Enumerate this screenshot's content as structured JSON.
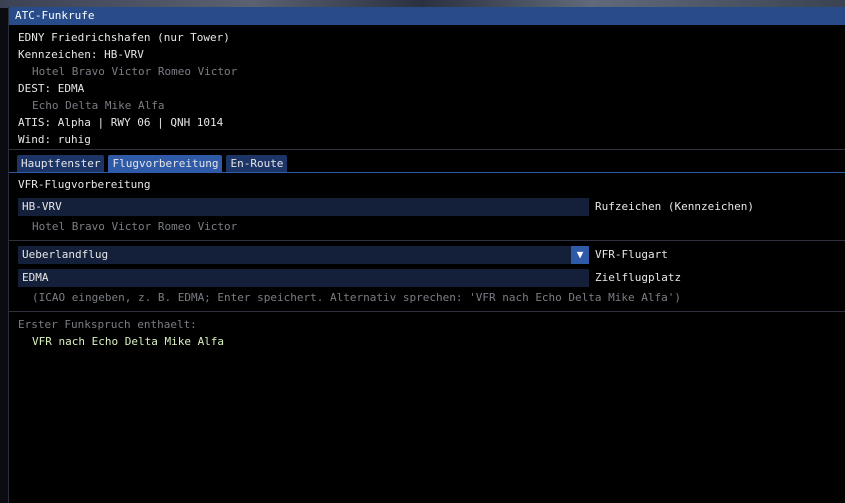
{
  "window": {
    "title": "ATC-Funkrufe"
  },
  "header": {
    "airport": "EDNY Friedrichshafen (nur Tower)",
    "registration": "Kennzeichen: HB-VRV",
    "registration_phonetic": "Hotel Bravo Victor Romeo Victor",
    "dest": "DEST: EDMA",
    "dest_phonetic": "Echo Delta Mike Alfa",
    "atis": "ATIS: Alpha | RWY 06 | QNH 1014",
    "wind": "Wind: ruhig"
  },
  "tabs": [
    {
      "label": "Hauptfenster",
      "active": false
    },
    {
      "label": "Flugvorbereitung",
      "active": true
    },
    {
      "label": "En-Route",
      "active": false
    }
  ],
  "prep": {
    "heading": "VFR-Flugvorbereitung",
    "callsign_value": "HB-VRV",
    "callsign_label": "Rufzeichen (Kennzeichen)",
    "callsign_phonetic": "Hotel Bravo Victor Romeo Victor",
    "flight_type_value": "Ueberlandflug",
    "flight_type_label": "VFR-Flugart",
    "destination_value": "EDMA",
    "destination_label": "Zielflugplatz",
    "destination_hint": "(ICAO eingeben, z. B. EDMA; Enter speichert. Alternativ sprechen: 'VFR nach Echo Delta Mike Alfa')",
    "first_call_label": "Erster Funkspruch enthaelt:",
    "first_call_text": "VFR nach Echo Delta Mike Alfa"
  },
  "colors": {
    "title_bar": "#284b8a",
    "tab_active": "#2e5aa8",
    "field_bg": "#14203a"
  },
  "icons": {
    "combo_arrow": "chevron-down-icon"
  }
}
